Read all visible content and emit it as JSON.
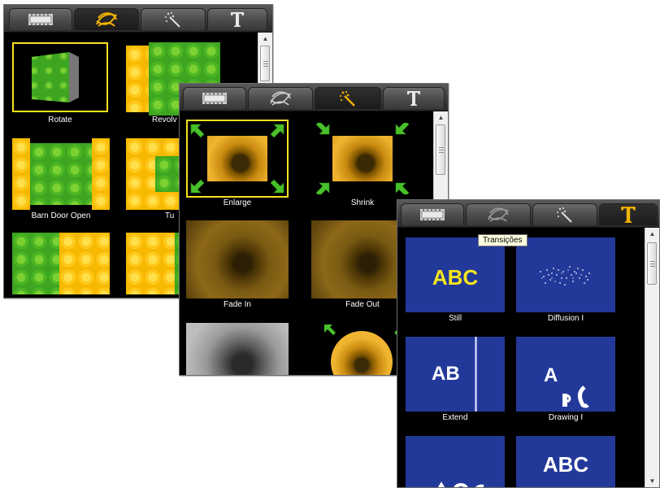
{
  "panel_transitions": {
    "items": [
      {
        "label": "Rotate"
      },
      {
        "label": "Revolv"
      },
      {
        "label": "Barn Door Open"
      },
      {
        "label": "Tu"
      }
    ]
  },
  "panel_effects": {
    "items": [
      {
        "label": "Enlarge"
      },
      {
        "label": "Shrink"
      },
      {
        "label": "Fade In"
      },
      {
        "label": "Fade Out"
      }
    ]
  },
  "panel_titles": {
    "tooltip": "Transições",
    "items": [
      {
        "label": "Still",
        "preview": "ABC"
      },
      {
        "label": "Diffusion I",
        "preview": ""
      },
      {
        "label": "Extend",
        "preview": "AB"
      },
      {
        "label": "Drawing I",
        "preview": "A"
      },
      {
        "label": "",
        "preview": ""
      },
      {
        "label": "",
        "preview": "ABC"
      }
    ]
  },
  "colors": {
    "selection": "#f5e21d",
    "title_preview_bg": "#23399a",
    "title_text_yellow": "#f7e61c",
    "active_icon": "#f2b400"
  }
}
